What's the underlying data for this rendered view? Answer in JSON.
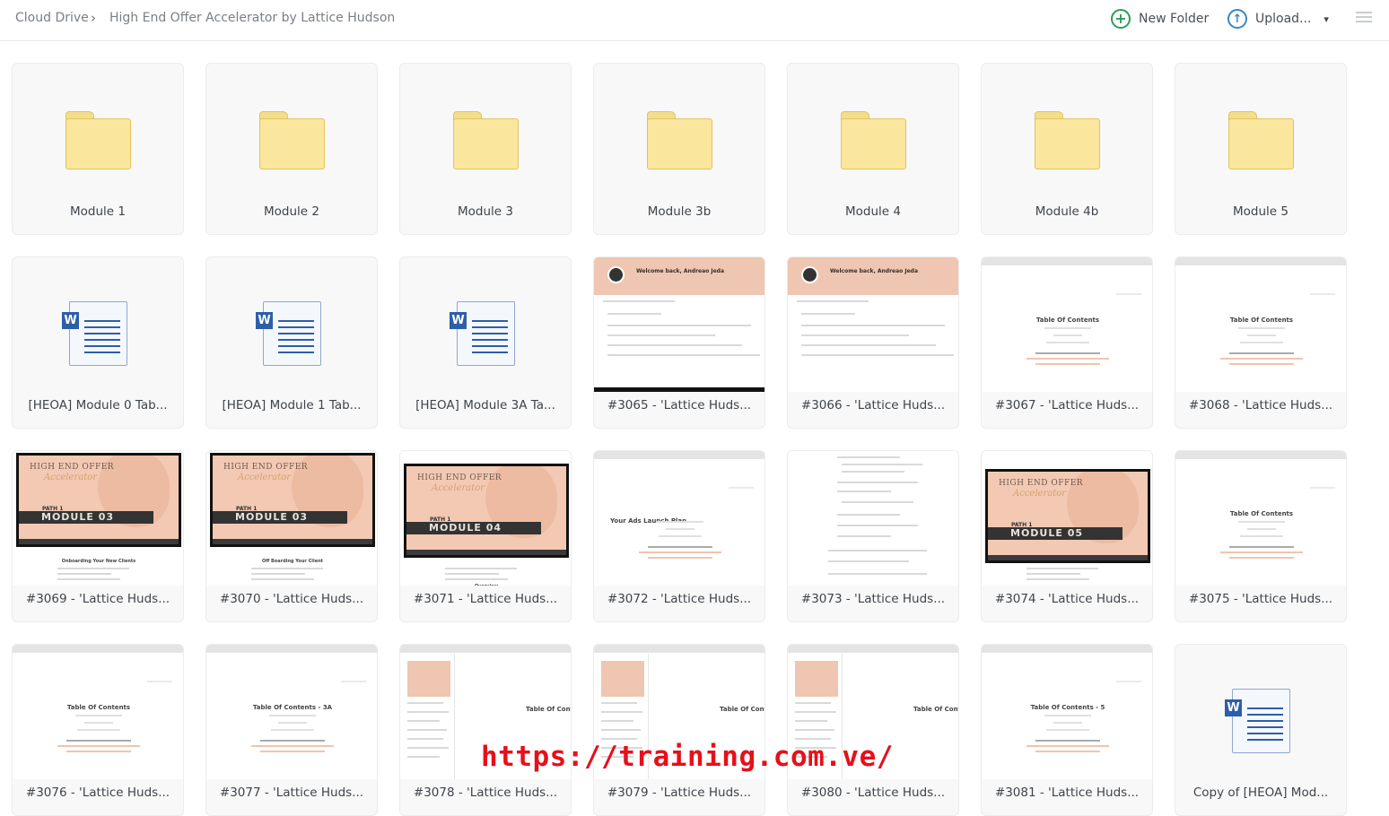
{
  "breadcrumb": {
    "root": "Cloud Drive",
    "separator": "›",
    "current": "High End Offer Accelerator by Lattice Hudson"
  },
  "toolbar": {
    "new_folder": "New Folder",
    "new_folder_icon": "plus-circle-icon",
    "upload": "Upload...",
    "upload_icon": "upload-arrow-circle-icon",
    "upload_caret": "▾",
    "view_icon": "list-view-icon",
    "accent_color": "#2e9a5a",
    "upload_color": "#3a86c8"
  },
  "items": [
    {
      "type": "folder",
      "label": "Module 1"
    },
    {
      "type": "folder",
      "label": "Module 2"
    },
    {
      "type": "folder",
      "label": "Module 3"
    },
    {
      "type": "folder",
      "label": "Module 3b"
    },
    {
      "type": "folder",
      "label": "Module 4"
    },
    {
      "type": "folder",
      "label": "Module 4b"
    },
    {
      "type": "folder",
      "label": "Module 5"
    },
    {
      "type": "doc",
      "label": "[HEOA] Module 0 Tab..."
    },
    {
      "type": "doc",
      "label": "[HEOA] Module 1 Tab..."
    },
    {
      "type": "doc",
      "label": "[HEOA] Module 3A Ta..."
    },
    {
      "type": "welcome",
      "label": "#3065 - 'Lattice Huds...",
      "title": "Welcome back, Andreao Jeda"
    },
    {
      "type": "welcome",
      "label": "#3066 - 'Lattice Huds...",
      "title": "Welcome back, Andreao Jeda"
    },
    {
      "type": "toc",
      "label": "#3067 - 'Lattice Huds...",
      "title": "Table Of Contents"
    },
    {
      "type": "toc",
      "label": "#3068 - 'Lattice Huds...",
      "title": "Table Of Contents"
    },
    {
      "type": "video",
      "label": "#3069 - 'Lattice Huds...",
      "module": "MODULE 03",
      "caption": "Onboarding Your New Clients"
    },
    {
      "type": "video",
      "label": "#3070 - 'Lattice Huds...",
      "module": "MODULE 03",
      "caption": "Off Boarding Your Client"
    },
    {
      "type": "video",
      "label": "#3071 - 'Lattice Huds...",
      "module": "MODULE 04",
      "caption": "Overview"
    },
    {
      "type": "plan",
      "label": "#3072 - 'Lattice Huds...",
      "title": "Your Ads Launch Plan"
    },
    {
      "type": "text",
      "label": "#3073 - 'Lattice Huds..."
    },
    {
      "type": "video",
      "label": "#3074 - 'Lattice Huds...",
      "module": "MODULE 05",
      "caption": ""
    },
    {
      "type": "toc",
      "label": "#3075 - 'Lattice Huds...",
      "title": "Table Of Contents"
    },
    {
      "type": "toc",
      "label": "#3076 - 'Lattice Huds...",
      "title": "Table Of Contents"
    },
    {
      "type": "toc",
      "label": "#3077 - 'Lattice Huds...",
      "title": "Table Of Contents - 3A"
    },
    {
      "type": "split",
      "label": "#3078 - 'Lattice Huds...",
      "title": "Table Of Cont"
    },
    {
      "type": "split",
      "label": "#3079 - 'Lattice Huds...",
      "title": "Table Of Cont"
    },
    {
      "type": "split",
      "label": "#3080 - 'Lattice Huds...",
      "title": "Table Of Cont"
    },
    {
      "type": "toc",
      "label": "#3081 - 'Lattice Huds...",
      "title": "Table Of Contents - 5"
    },
    {
      "type": "doc",
      "label": "Copy of [HEOA] Mod..."
    }
  ],
  "video_texts": {
    "headline": "HIGH END OFFER",
    "script": "Accelerator",
    "path": "PATH 1"
  },
  "watermark": "https://training.com.ve/"
}
